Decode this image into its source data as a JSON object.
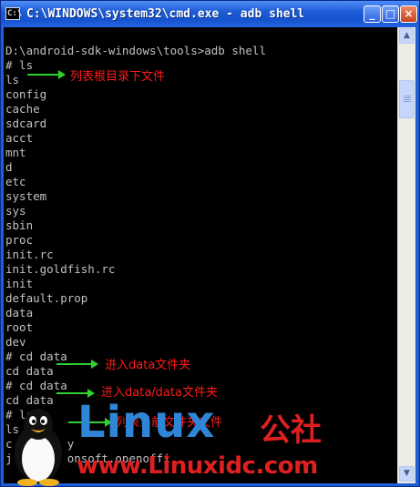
{
  "window": {
    "title": "C:\\WINDOWS\\system32\\cmd.exe - adb shell",
    "icon_label": "C:\\",
    "buttons": {
      "minimize": "_",
      "maximize": "□",
      "close": "×"
    }
  },
  "console_lines": [
    "",
    "D:\\android-sdk-windows\\tools>adb shell",
    "# ls",
    "ls",
    "config",
    "cache",
    "sdcard",
    "acct",
    "mnt",
    "d",
    "etc",
    "system",
    "sys",
    "sbin",
    "proc",
    "init.rc",
    "init.goldfish.rc",
    "init",
    "default.prop",
    "data",
    "root",
    "dev",
    "# cd data",
    "cd data",
    "# cd data",
    "cd data",
    "# ls",
    "ls",
    "c        y",
    "j        onsoft.openoffi"
  ],
  "annotations": [
    "列表根目录下文件",
    "进入data文件夹",
    "进入data/data文件夹",
    "列表当前文件夹文件"
  ],
  "watermark": {
    "brand": "Linux",
    "brand_suffix": "公社",
    "url": "www.Linuxidc.com"
  },
  "scrollbar": {
    "up_arrow": "▲",
    "down_arrow": "▼"
  }
}
